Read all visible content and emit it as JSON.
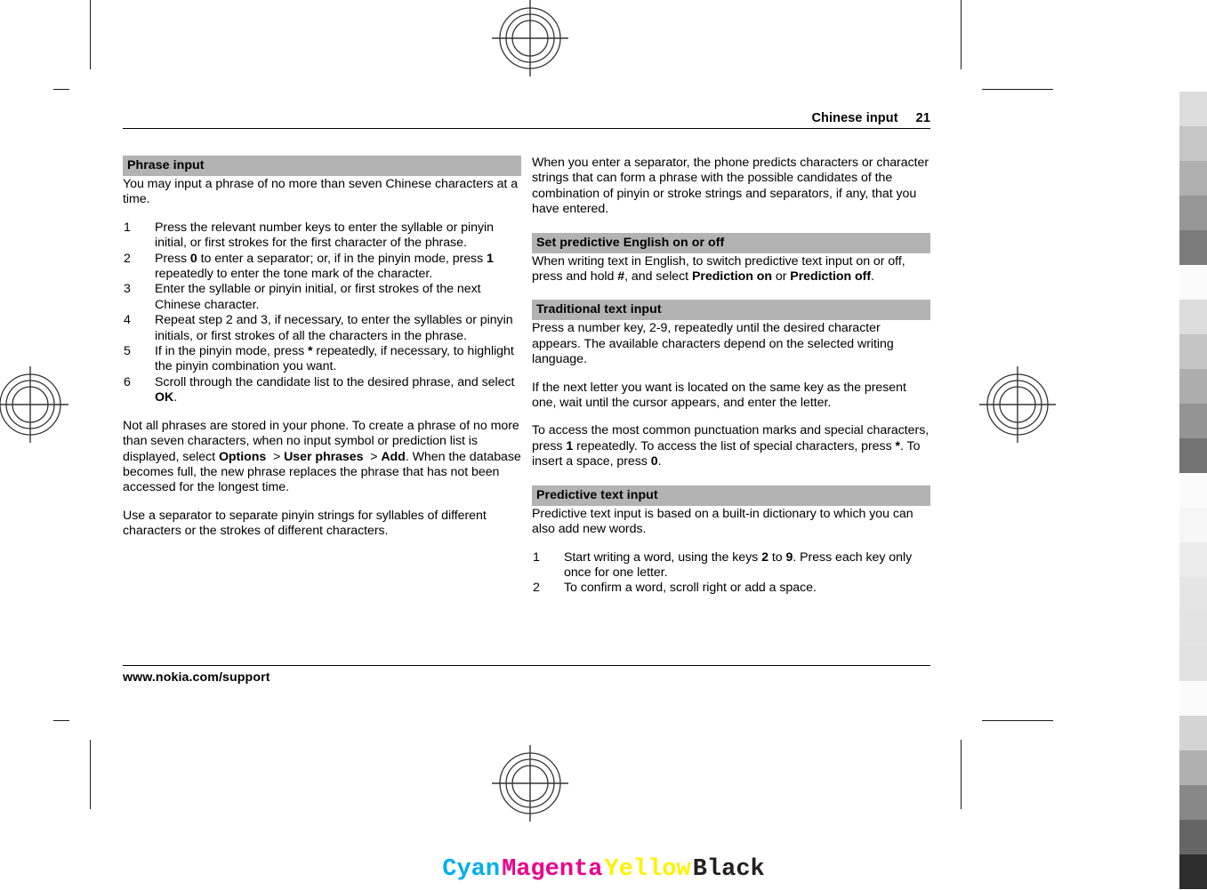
{
  "page": {
    "header": {
      "title": "Chinese input",
      "page_number": "21"
    },
    "footer": {
      "url": "www.nokia.com/support"
    }
  },
  "left_column": {
    "section_heading": "Phrase input",
    "intro": "You may input a phrase of no more than seven Chinese characters at a time.",
    "steps": [
      {
        "num": "1",
        "text_html": "Press the relevant number keys to enter the syllable or pinyin initial, or first strokes for the first character of the phrase."
      },
      {
        "num": "2",
        "text_html": "Press <b>0</b> to enter a separator; or, if in the pinyin mode, press <b>1</b> repeatedly to enter the tone mark of the character."
      },
      {
        "num": "3",
        "text_html": "Enter the syllable or pinyin initial, or first strokes of the next Chinese character."
      },
      {
        "num": "4",
        "text_html": "Repeat step 2 and 3, if necessary, to enter the syllables or pinyin initials, or first strokes of all the characters in the phrase."
      },
      {
        "num": "5",
        "text_html": "If in the pinyin mode, press <b>*</b> repeatedly, if necessary, to highlight the pinyin combination you want."
      },
      {
        "num": "6",
        "text_html": "Scroll through the candidate list to the desired phrase, and select <b>OK</b>."
      }
    ],
    "para_user_phrases_html": "Not all phrases are stored in your phone. To create a phrase of no more than seven characters, when no input symbol or prediction list is displayed, select <b>Options</b> &nbsp;&gt; <b>User phrases</b> &nbsp;&gt; <b>Add</b>. When the database becomes full, the new phrase replaces the phrase that has not been accessed for the longest time.",
    "para_separator": "Use a separator to separate pinyin strings for syllables of different characters or the strokes of different characters."
  },
  "right_column": {
    "para_separator_predict": "When you enter a separator, the phone predicts characters or character strings that can form a phrase with the possible candidates of the combination of pinyin or stroke strings and separators, if any, that you have entered.",
    "section_predictive_english": {
      "heading": "Set predictive English on or off",
      "body_html": "When writing text in English, to switch predictive text input on or off, press and hold <b>#</b>, and select <b>Prediction on</b> or <b>Prediction off</b>."
    },
    "section_traditional": {
      "heading": "Traditional text input",
      "para1": "Press a number key, 2-9, repeatedly until the desired character appears. The available characters depend on the selected writing language.",
      "para2": "If the next letter you want is located on the same key as the present one, wait until the cursor appears, and enter the letter.",
      "para3_html": "To access the most common punctuation marks and special characters, press <b>1</b> repeatedly. To access the list of special characters, press <b>*</b>. To insert a space, press <b>0</b>."
    },
    "section_predictive": {
      "heading": "Predictive text input",
      "intro": "Predictive text input is based on a built-in dictionary to which you can also add new words.",
      "steps": [
        {
          "num": "1",
          "text_html": "Start writing a word, using the keys <b>2</b> to <b>9</b>. Press each key only once for one letter."
        },
        {
          "num": "2",
          "text_html": "To confirm a word, scroll right or add a space."
        }
      ]
    }
  },
  "color_bar": {
    "items": [
      {
        "label": "Cyan",
        "color": "#00aeef"
      },
      {
        "label": "Magenta",
        "color": "#ec008c"
      },
      {
        "label": "Yellow",
        "color": "#fff200"
      },
      {
        "label": "Black",
        "color": "#231f20"
      }
    ]
  },
  "gray_strip": {
    "swatches": [
      "#ffffff",
      "#dddddd",
      "#c6c6c6",
      "#afafaf",
      "#979797",
      "#7b7b7b",
      "#fbfbfb",
      "#dcdcdc",
      "#c5c5c5",
      "#adadad",
      "#949494",
      "#727272",
      "#fbfbfb",
      "#f6f6f6",
      "#ebebeb",
      "#e5e5e5",
      "#e3e3e3",
      "#e1e1e1",
      "#fbfbfb",
      "#d4d4d4",
      "#b0b0b0",
      "#888888",
      "#656565",
      "#2d2d2d"
    ]
  }
}
